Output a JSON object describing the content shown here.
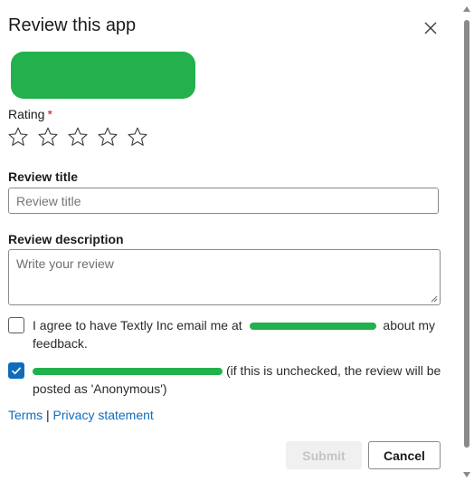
{
  "dialog": {
    "title": "Review this app",
    "close_icon": "close-icon"
  },
  "rating": {
    "label": "Rating",
    "required_mark": "*",
    "stars_total": 5,
    "stars_selected": 0,
    "star_icon": "star-outline-icon"
  },
  "review_title": {
    "label": "Review title",
    "placeholder": "Review title",
    "value": ""
  },
  "review_description": {
    "label": "Review description",
    "placeholder": "Write your review",
    "value": ""
  },
  "consent": {
    "email_text_before": "I agree to have Textly Inc email me at",
    "email_text_after": "about my feedback.",
    "email_checked": false,
    "public_text_after": "(if this is unchecked, the review will be posted as 'Anonymous')",
    "public_checked": true
  },
  "links": {
    "terms": "Terms",
    "separator": "|",
    "privacy": "Privacy statement"
  },
  "buttons": {
    "submit": "Submit",
    "cancel": "Cancel"
  },
  "colors": {
    "accent": "#0f6cbd",
    "required": "#c50f1f",
    "redaction": "#22b14c"
  }
}
